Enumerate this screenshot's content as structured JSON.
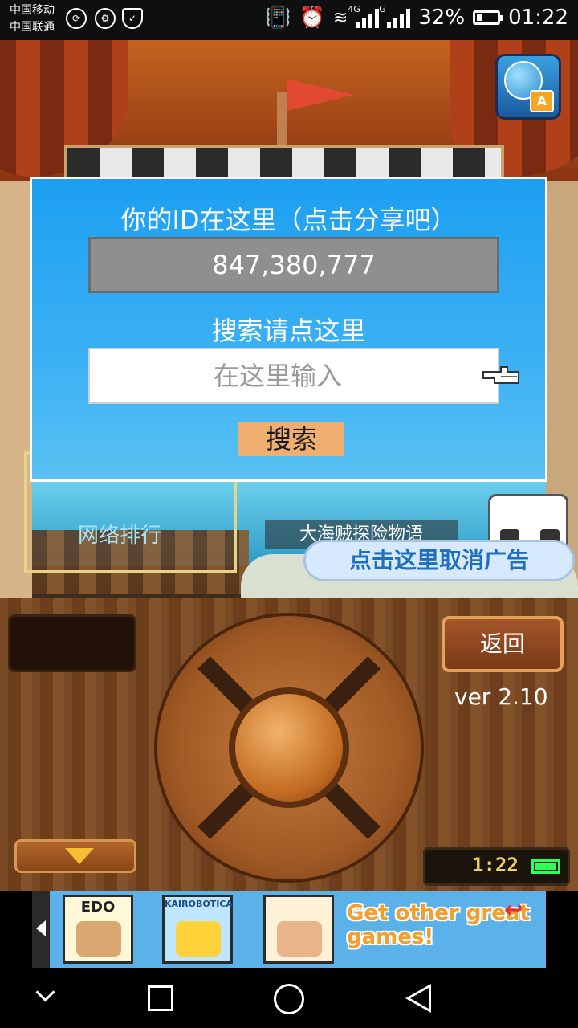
{
  "status_bar": {
    "carrier_1": "中国移动",
    "carrier_2": "中国联通",
    "network_1": "4G",
    "network_2": "G",
    "battery": "32%",
    "time": "01:22"
  },
  "game": {
    "rank_label": "网络排行",
    "story_label": "大海贼探险物语",
    "remove_ads": "点击这里取消广告",
    "lang_badge": "A"
  },
  "dialog": {
    "title": "你的ID在这里（点击分享吧）",
    "player_id": "847,380,777",
    "search_title": "搜索请点这里",
    "search_placeholder": "在这里输入",
    "search_button": "搜索"
  },
  "panel": {
    "back_button": "返回",
    "version": "ver 2.10",
    "clock": "1:22"
  },
  "ad_banner": {
    "tiles": [
      "EDO",
      "KAIROBOTICA",
      ""
    ],
    "promo": "Get other great games!"
  },
  "colors": {
    "dialog_bg": "#1c9ff1",
    "search_button_bg": "#f0ae6f",
    "remove_ads_text": "#1e6fbf"
  }
}
